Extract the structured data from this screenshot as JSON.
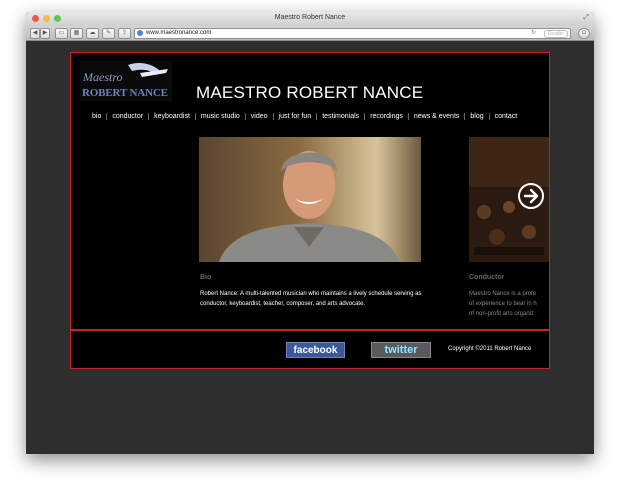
{
  "window": {
    "title": "Maestro Robert Nance",
    "url": "www.maestronance.com",
    "reader_label": "Reader",
    "reload_icon": "reload-icon"
  },
  "site": {
    "title": "MAESTRO ROBERT NANCE",
    "logo": {
      "text_top": "Maestro",
      "text_bottom": "ROBERT NANCE"
    },
    "nav": [
      "bio",
      "conductor",
      "keyboardist",
      "music studio",
      "video",
      "just for fun",
      "testimonials",
      "recordings",
      "news & events",
      "blog",
      "contact"
    ],
    "cards": [
      {
        "title": "Bio",
        "text": "Robert Nance: A multi-talented musician who maintains a lively schedule serving as conductor, keyboardist, teacher, composer, and arts advocate."
      },
      {
        "title": "Conductor",
        "lines": [
          "Maestro Nance is a profe",
          "of experience to bear in h",
          "of non-profit arts organiz"
        ]
      }
    ],
    "footer": {
      "facebook": "facebook",
      "twitter": "twitter",
      "copyright": "Copyright ©2011 Robert Nance"
    },
    "colors": {
      "accent_red": "#cc1f1f",
      "background": "#000000",
      "facebook_blue": "#3b5998"
    }
  }
}
